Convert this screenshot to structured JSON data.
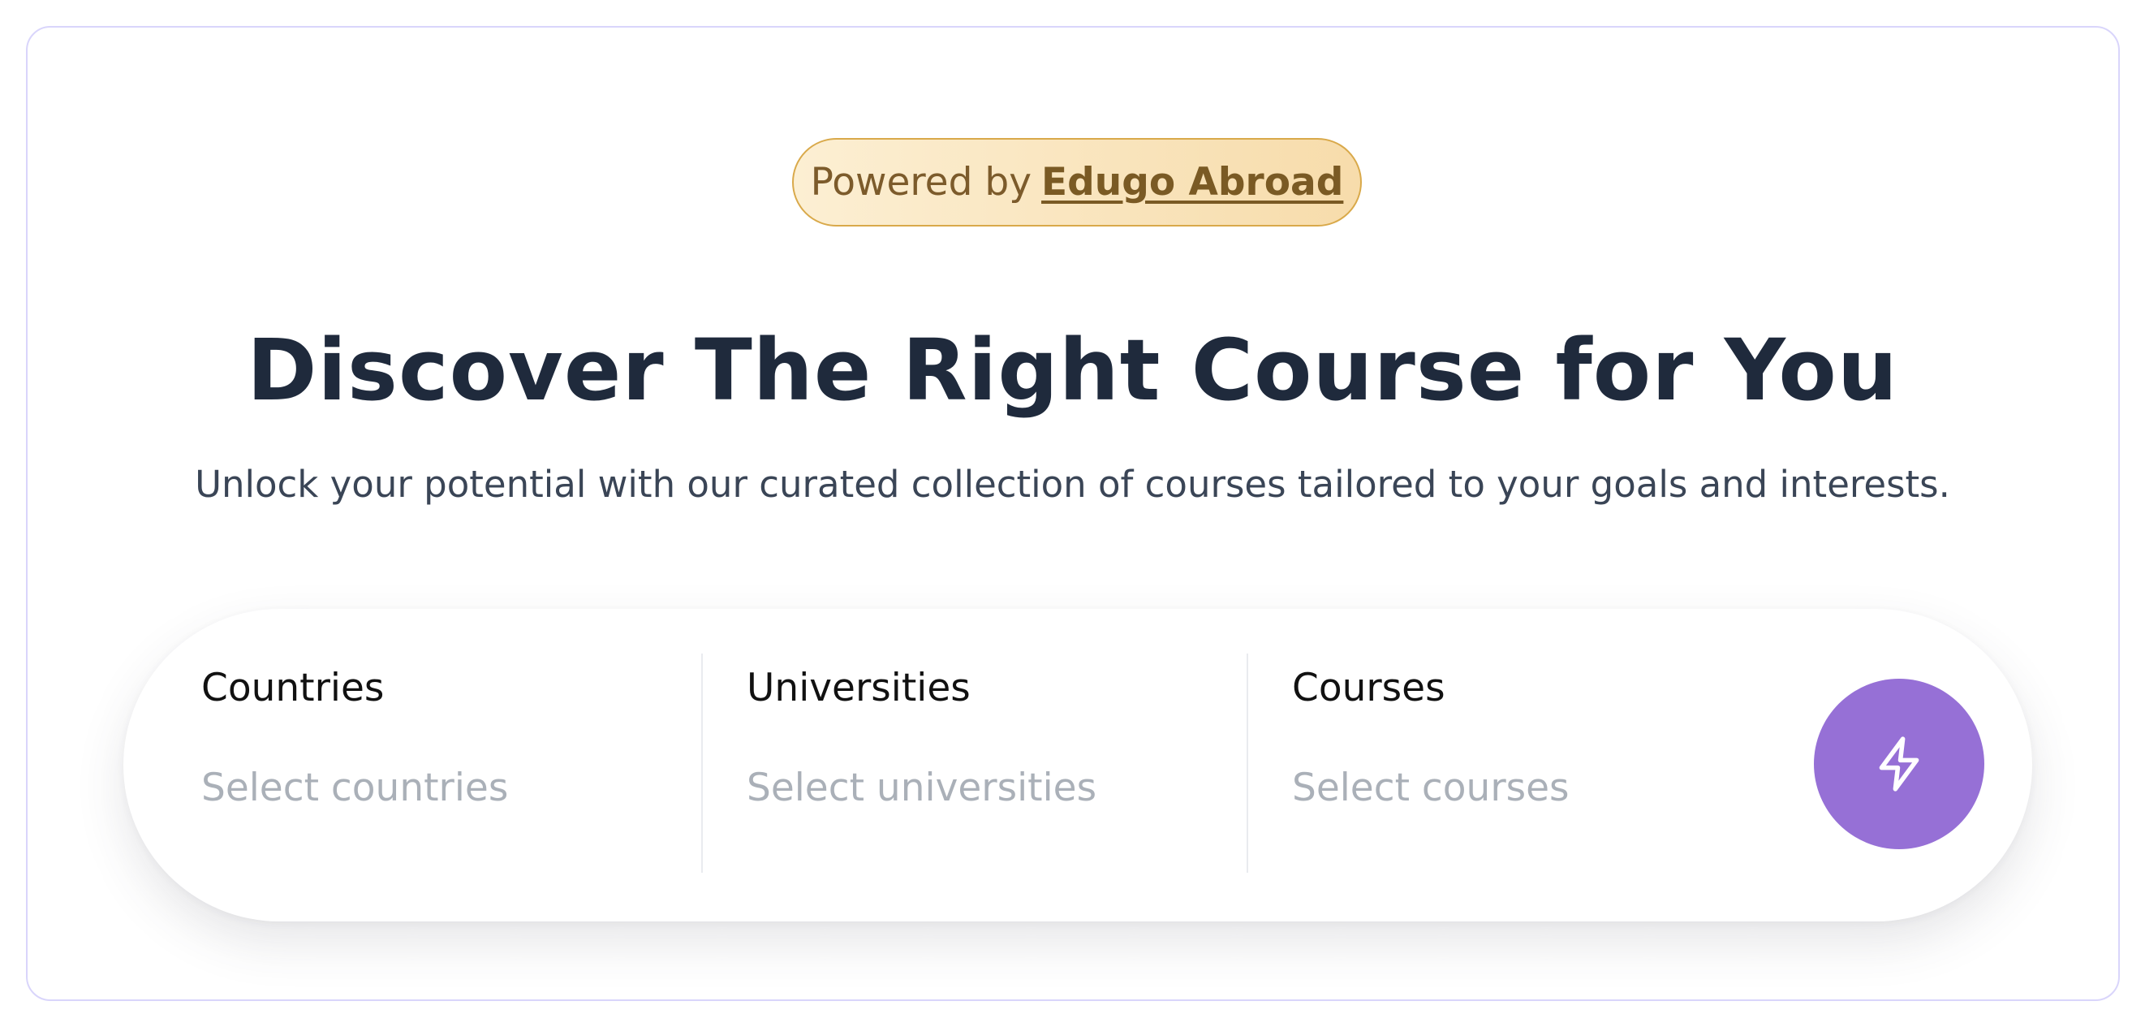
{
  "badge": {
    "prefix": "Powered by",
    "brand": "Edugo Abroad"
  },
  "hero": {
    "title": "Discover The Right Course for You",
    "subtitle": "Unlock your potential with our curated collection of courses tailored to your goals and interests."
  },
  "search": {
    "fields": [
      {
        "label": "Countries",
        "placeholder": "Select countries"
      },
      {
        "label": "Universities",
        "placeholder": "Select universities"
      },
      {
        "label": "Courses",
        "placeholder": "Select courses"
      }
    ],
    "button_icon": "lightning-bolt-icon"
  },
  "colors": {
    "accent": "#9670d6",
    "badge_text": "#7c5b2b",
    "title": "#1f2a3c",
    "card_border": "#d9d5fb"
  }
}
